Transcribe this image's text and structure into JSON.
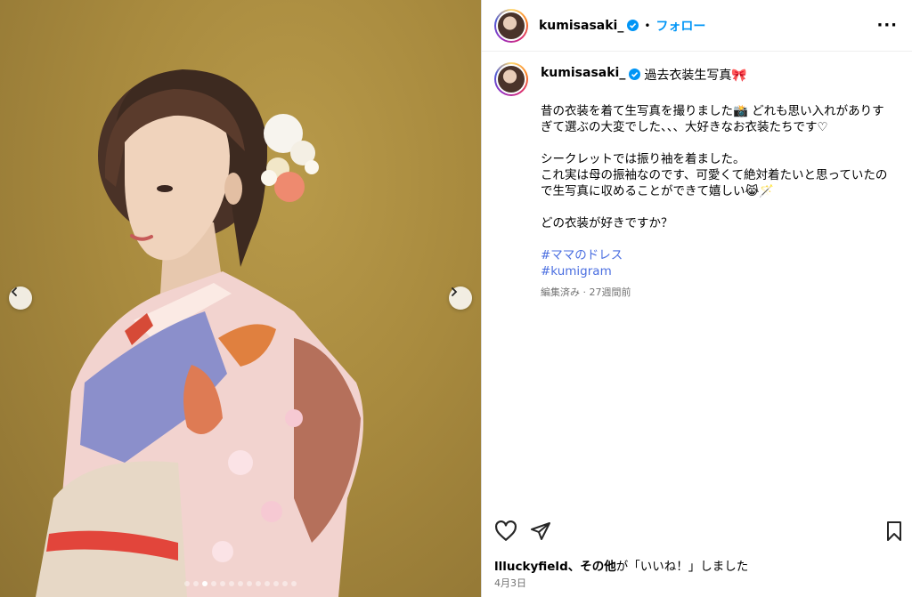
{
  "post": {
    "username": "kumisasaki_",
    "separator": "•",
    "follow_label": "フォロー",
    "more_label": "···",
    "caption_title": "過去衣装生写真🎀",
    "caption_paragraphs": [
      "昔の衣装を着て生写真を撮りました📸 どれも思い入れがありすぎて選ぶの大変でした、、、大好きなお衣装たちです♡",
      "シークレットでは振り袖を着ました。\nこれ実は母の振袖なのです、可愛くて絶対着たいと思っていたので生写真に収めることができて嬉しい😹🪄",
      "どの衣装が好きですか？"
    ],
    "hashtags": [
      "#ママのドレス",
      "#kumigram"
    ],
    "meta": "編集済み · 27週間前",
    "likes_user": "llluckyfield、",
    "likes_others": "その他",
    "likes_suffix": "が「いいね！」しました",
    "date": "4月3日"
  },
  "carousel": {
    "dot_count": 13,
    "active_index": 2
  },
  "icons": {
    "verified": "verified-badge-icon",
    "like": "heart-icon",
    "share": "paper-plane-icon",
    "save": "bookmark-icon",
    "prev": "chevron-left-icon",
    "next": "chevron-right-icon"
  },
  "colors": {
    "accent": "#0095f6",
    "hashtag": "#4a6ee0",
    "muted": "#737373"
  }
}
